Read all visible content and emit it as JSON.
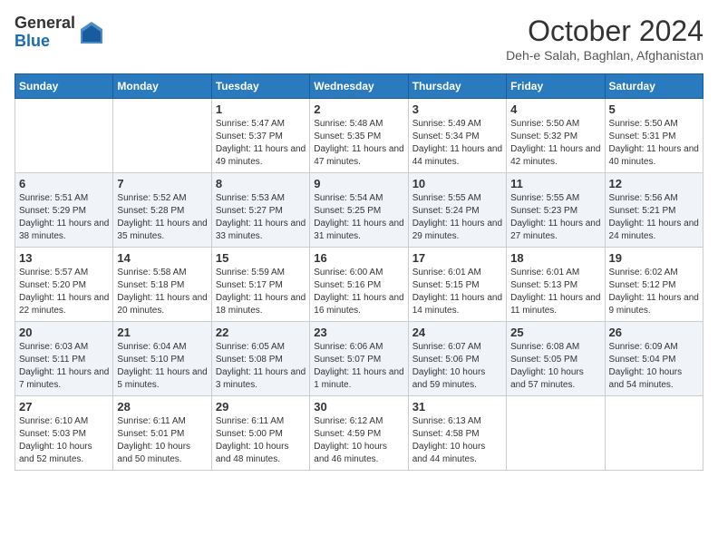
{
  "header": {
    "logo_general": "General",
    "logo_blue": "Blue",
    "month_title": "October 2024",
    "location": "Deh-e Salah, Baghlan, Afghanistan"
  },
  "weekdays": [
    "Sunday",
    "Monday",
    "Tuesday",
    "Wednesday",
    "Thursday",
    "Friday",
    "Saturday"
  ],
  "weeks": [
    [
      {
        "day": "",
        "content": ""
      },
      {
        "day": "",
        "content": ""
      },
      {
        "day": "1",
        "content": "Sunrise: 5:47 AM\nSunset: 5:37 PM\nDaylight: 11 hours and 49 minutes."
      },
      {
        "day": "2",
        "content": "Sunrise: 5:48 AM\nSunset: 5:35 PM\nDaylight: 11 hours and 47 minutes."
      },
      {
        "day": "3",
        "content": "Sunrise: 5:49 AM\nSunset: 5:34 PM\nDaylight: 11 hours and 44 minutes."
      },
      {
        "day": "4",
        "content": "Sunrise: 5:50 AM\nSunset: 5:32 PM\nDaylight: 11 hours and 42 minutes."
      },
      {
        "day": "5",
        "content": "Sunrise: 5:50 AM\nSunset: 5:31 PM\nDaylight: 11 hours and 40 minutes."
      }
    ],
    [
      {
        "day": "6",
        "content": "Sunrise: 5:51 AM\nSunset: 5:29 PM\nDaylight: 11 hours and 38 minutes."
      },
      {
        "day": "7",
        "content": "Sunrise: 5:52 AM\nSunset: 5:28 PM\nDaylight: 11 hours and 35 minutes."
      },
      {
        "day": "8",
        "content": "Sunrise: 5:53 AM\nSunset: 5:27 PM\nDaylight: 11 hours and 33 minutes."
      },
      {
        "day": "9",
        "content": "Sunrise: 5:54 AM\nSunset: 5:25 PM\nDaylight: 11 hours and 31 minutes."
      },
      {
        "day": "10",
        "content": "Sunrise: 5:55 AM\nSunset: 5:24 PM\nDaylight: 11 hours and 29 minutes."
      },
      {
        "day": "11",
        "content": "Sunrise: 5:55 AM\nSunset: 5:23 PM\nDaylight: 11 hours and 27 minutes."
      },
      {
        "day": "12",
        "content": "Sunrise: 5:56 AM\nSunset: 5:21 PM\nDaylight: 11 hours and 24 minutes."
      }
    ],
    [
      {
        "day": "13",
        "content": "Sunrise: 5:57 AM\nSunset: 5:20 PM\nDaylight: 11 hours and 22 minutes."
      },
      {
        "day": "14",
        "content": "Sunrise: 5:58 AM\nSunset: 5:18 PM\nDaylight: 11 hours and 20 minutes."
      },
      {
        "day": "15",
        "content": "Sunrise: 5:59 AM\nSunset: 5:17 PM\nDaylight: 11 hours and 18 minutes."
      },
      {
        "day": "16",
        "content": "Sunrise: 6:00 AM\nSunset: 5:16 PM\nDaylight: 11 hours and 16 minutes."
      },
      {
        "day": "17",
        "content": "Sunrise: 6:01 AM\nSunset: 5:15 PM\nDaylight: 11 hours and 14 minutes."
      },
      {
        "day": "18",
        "content": "Sunrise: 6:01 AM\nSunset: 5:13 PM\nDaylight: 11 hours and 11 minutes."
      },
      {
        "day": "19",
        "content": "Sunrise: 6:02 AM\nSunset: 5:12 PM\nDaylight: 11 hours and 9 minutes."
      }
    ],
    [
      {
        "day": "20",
        "content": "Sunrise: 6:03 AM\nSunset: 5:11 PM\nDaylight: 11 hours and 7 minutes."
      },
      {
        "day": "21",
        "content": "Sunrise: 6:04 AM\nSunset: 5:10 PM\nDaylight: 11 hours and 5 minutes."
      },
      {
        "day": "22",
        "content": "Sunrise: 6:05 AM\nSunset: 5:08 PM\nDaylight: 11 hours and 3 minutes."
      },
      {
        "day": "23",
        "content": "Sunrise: 6:06 AM\nSunset: 5:07 PM\nDaylight: 11 hours and 1 minute."
      },
      {
        "day": "24",
        "content": "Sunrise: 6:07 AM\nSunset: 5:06 PM\nDaylight: 10 hours and 59 minutes."
      },
      {
        "day": "25",
        "content": "Sunrise: 6:08 AM\nSunset: 5:05 PM\nDaylight: 10 hours and 57 minutes."
      },
      {
        "day": "26",
        "content": "Sunrise: 6:09 AM\nSunset: 5:04 PM\nDaylight: 10 hours and 54 minutes."
      }
    ],
    [
      {
        "day": "27",
        "content": "Sunrise: 6:10 AM\nSunset: 5:03 PM\nDaylight: 10 hours and 52 minutes."
      },
      {
        "day": "28",
        "content": "Sunrise: 6:11 AM\nSunset: 5:01 PM\nDaylight: 10 hours and 50 minutes."
      },
      {
        "day": "29",
        "content": "Sunrise: 6:11 AM\nSunset: 5:00 PM\nDaylight: 10 hours and 48 minutes."
      },
      {
        "day": "30",
        "content": "Sunrise: 6:12 AM\nSunset: 4:59 PM\nDaylight: 10 hours and 46 minutes."
      },
      {
        "day": "31",
        "content": "Sunrise: 6:13 AM\nSunset: 4:58 PM\nDaylight: 10 hours and 44 minutes."
      },
      {
        "day": "",
        "content": ""
      },
      {
        "day": "",
        "content": ""
      }
    ]
  ]
}
